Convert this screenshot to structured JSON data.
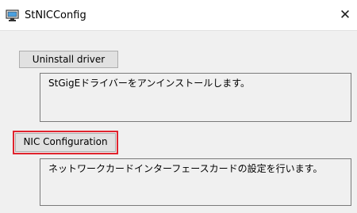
{
  "window": {
    "title": "StNICConfig",
    "close_glyph": "✕",
    "icon": "app-icon"
  },
  "uninstall": {
    "button_label": "Uninstall driver",
    "description": "StGigEドライバーをアンインストールします。"
  },
  "nic": {
    "button_label": "NIC Configuration",
    "description": "ネットワークカードインターフェースカードの設定を行います。"
  },
  "colors": {
    "highlight_border": "#e0242e",
    "client_background": "#f0f0f0"
  }
}
